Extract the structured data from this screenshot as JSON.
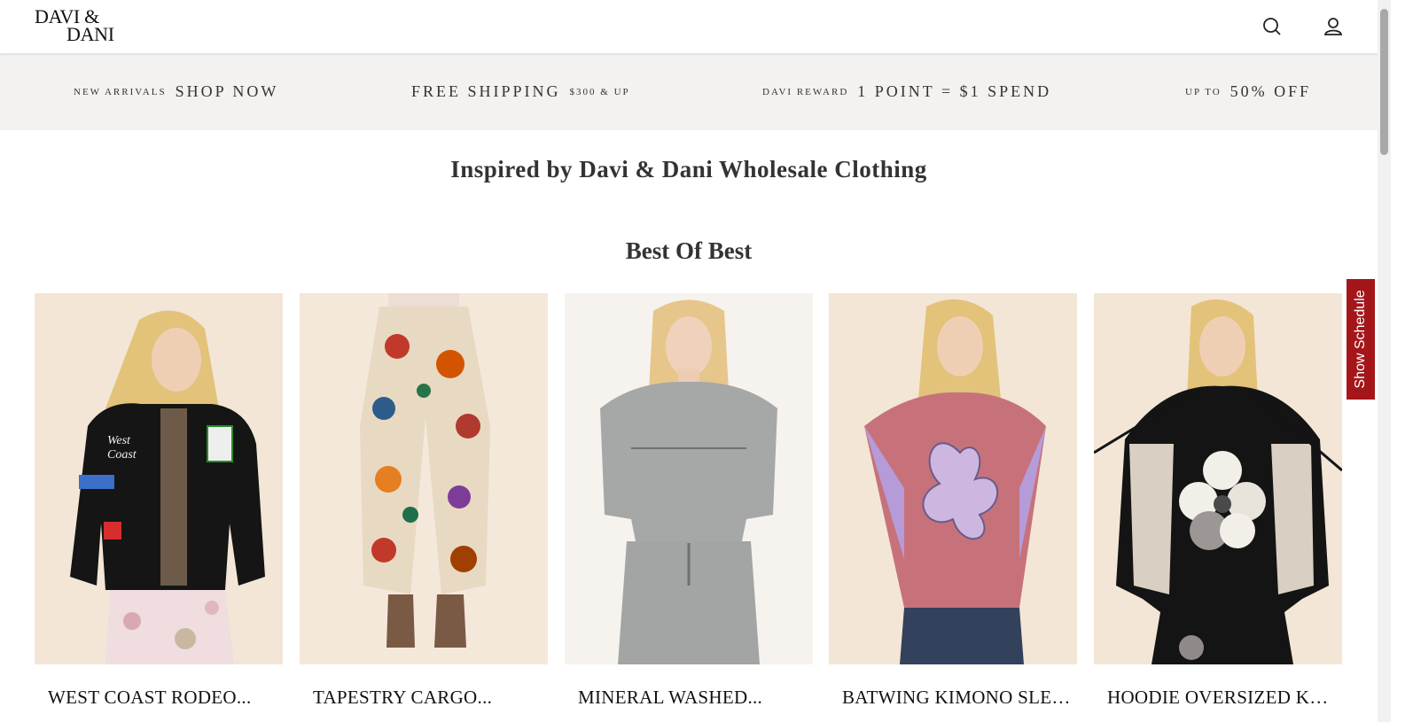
{
  "header": {
    "logo_line1": "DAVI &",
    "logo_line2": "DANI"
  },
  "promo": [
    {
      "small": "NEW ARRIVALS",
      "big": "SHOP NOW"
    },
    {
      "big": "FREE SHIPPING",
      "small": "$300 & UP"
    },
    {
      "small": "DAVI REWARD",
      "big": "1 POINT = $1 SPEND"
    },
    {
      "small": "UP TO",
      "big": "50% OFF"
    }
  ],
  "subtitle": "Inspired by Davi & Dani Wholesale Clothing",
  "section_title": "Best Of Best",
  "products": [
    {
      "name": "WEST COAST RODEO..."
    },
    {
      "name": "TAPESTRY CARGO..."
    },
    {
      "name": "MINERAL WASHED..."
    },
    {
      "name": "BATWING KIMONO SLEEV..."
    },
    {
      "name": "HOODIE OVERSIZED KNNI..."
    }
  ],
  "schedule_tab": "Show Schedule",
  "icons": {
    "search": "search-icon",
    "account": "user-icon"
  },
  "colors": {
    "promo_bg": "#f3f2f0",
    "schedule_tab": "#a4161a",
    "photo_bg": "#f3e6d6"
  }
}
